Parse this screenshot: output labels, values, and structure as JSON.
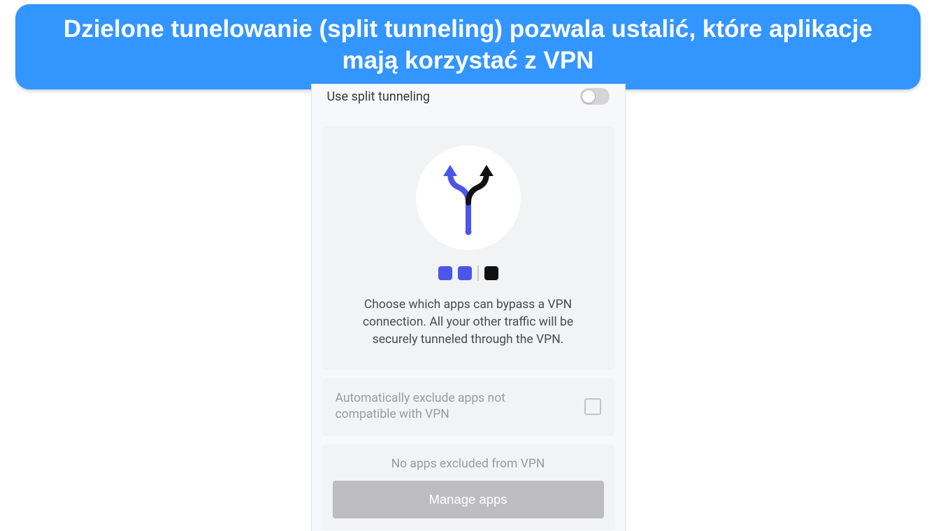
{
  "banner": {
    "text": "Dzielone tunelowanie (split tunneling) pozwala ustalić, które aplikacje mają korzystać z VPN"
  },
  "settings": {
    "use_split_label": "Use split tunneling",
    "use_split_enabled": false,
    "info_description": "Choose which apps can bypass a VPN connection. All your other traffic will be securely tunneled through the VPN.",
    "auto_exclude_label": "Automatically exclude apps not compatible with VPN",
    "auto_exclude_checked": false,
    "no_apps_text": "No apps excluded from VPN",
    "manage_button_label": "Manage apps"
  },
  "colors": {
    "accent_blue": "#4b55e8",
    "banner_blue": "#3396ff"
  }
}
